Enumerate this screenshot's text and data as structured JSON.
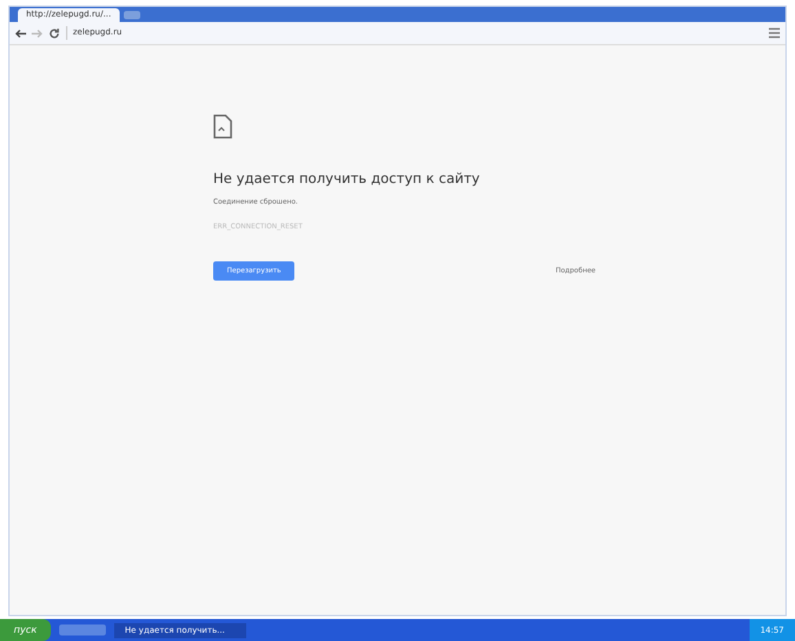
{
  "tabs": [
    {
      "title": "http://zelepugd.ru/...",
      "selected": true
    }
  ],
  "address_bar": {
    "url": "zelepugd.ru"
  },
  "error": {
    "heading": "Не удается получить доступ к сайту",
    "message": "Соединение сброшено.",
    "code": "ERR_CONNECTION_RESET",
    "reload_button": "Перезагрузить",
    "details_link": "Подробнее"
  },
  "taskbar": {
    "start": "пуск",
    "windows": [
      {
        "title": "Не удается получить...",
        "selected": true
      }
    ],
    "clock": "14:57"
  }
}
